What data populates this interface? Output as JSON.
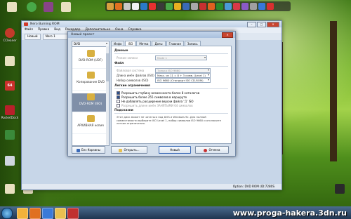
{
  "desktop": {
    "icons": [
      {
        "label": "ССleaner",
        "color": "#c23a2a"
      },
      {
        "label": "",
        "color": "#e8e0c0"
      },
      {
        "label": "",
        "color": "#e8e0c0"
      },
      {
        "label": "",
        "color": "#c9302c"
      },
      {
        "label": "RocketDock",
        "color": "#b8202a"
      },
      {
        "label": "",
        "color": "#3a8a3a"
      },
      {
        "label": "",
        "color": "#cfd6e0"
      },
      {
        "label": "",
        "color": "#2a6a2a"
      },
      {
        "label": "",
        "color": "#e8e0c0"
      },
      {
        "label": "",
        "color": "#e8e0c0"
      }
    ],
    "top_icons": [
      {
        "label": "",
        "color": "#e8e0c0"
      },
      {
        "label": "",
        "color": "#48a848"
      },
      {
        "label": "",
        "color": "#884488"
      },
      {
        "label": "",
        "color": "#e8e0c0"
      }
    ],
    "right_icon": {
      "label": "",
      "color": "#2a2a2a"
    }
  },
  "dock_colors": [
    "#d8a040",
    "#e07020",
    "#c8c8c8",
    "#f2f2f2",
    "#2a7ac8",
    "#e83030",
    "#3a3a3a",
    "#48a848",
    "#e8b020",
    "#3a6ab8",
    "#a8a8a8",
    "#c83030",
    "#e06020",
    "#2a8a2a",
    "#4a9ad8",
    "#d83848",
    "#8a5ac8",
    "#a0a0a0",
    "#3878d8",
    "#d83030"
  ],
  "app": {
    "title": "Nero Burning ROM",
    "menu": [
      "Файл",
      "Правка",
      "Вид",
      "Рекордер",
      "Дополнительно",
      "Окна",
      "Справка"
    ],
    "toolbar": {
      "new_label": "Новый",
      "recorder_label": "Nero 1"
    },
    "status": "Option: DVD ROM (ID:7280S"
  },
  "dialog": {
    "title": "Новый проект",
    "media_select": "DVD",
    "project_types": [
      {
        "label": "DVD-ROM (UDF)",
        "color": "#d8b040"
      },
      {
        "label": "Копирование DVD",
        "color": "#d8b040"
      },
      {
        "label": "DVD-ROM (ISO)",
        "color": "#d8b040"
      },
      {
        "label": "АРХИВНАЯ копия",
        "color": "#d8b040"
      }
    ],
    "tabs": [
      "Инфо",
      "ISO",
      "Метка",
      "Даты",
      "Главная",
      "Запись"
    ],
    "sections": {
      "data": "Данные",
      "file": "Файл",
      "limits": "Легкие ограничения",
      "hint": "Подсказки"
    },
    "fields": {
      "mode_label": "Режим записи",
      "mode_value": "Mode 1",
      "fs_label": "Файловая система",
      "fs_value": "Только ISO 9660",
      "len_label": "Длина имён файлов (ISO)",
      "len_value": "Макс. из 11 = 8 + 3 симв. (Level 1)",
      "charset_label": "Набор символов (ISO)",
      "charset_value": "ISO 9660 (Стандарт ISO CD-ROM)"
    },
    "checks": [
      {
        "label": "Разрешить глубину вложенности более 8 каталогов",
        "on": true,
        "dim": false
      },
      {
        "label": "Разрешить более 255 символов в маршруте",
        "on": true,
        "dim": false
      },
      {
        "label": "Не добавлять расширение версии файла ';1' ISO",
        "on": false,
        "dim": false
      },
      {
        "label": "Разрешить длине имён ЗАНЯТЫМИ 64 символов",
        "on": false,
        "dim": true
      }
    ],
    "hint_text": "Этот диск может не читаться под DOS и Windows 9x. Для полной совместимости выберите ISO Level 1, набор символов ISO 9660 и отключите легкие ограничения.",
    "buttons": {
      "help": "Без Корзины",
      "open": "Открыть...",
      "new": "Новый",
      "cancel": "Отмена"
    }
  },
  "taskbar": {
    "apps": [
      "#f2b23a",
      "#e07020",
      "#3a7ad8",
      "#e8c050",
      "#c03030"
    ]
  },
  "watermark": "www.proga-hakera.3dn.ru"
}
